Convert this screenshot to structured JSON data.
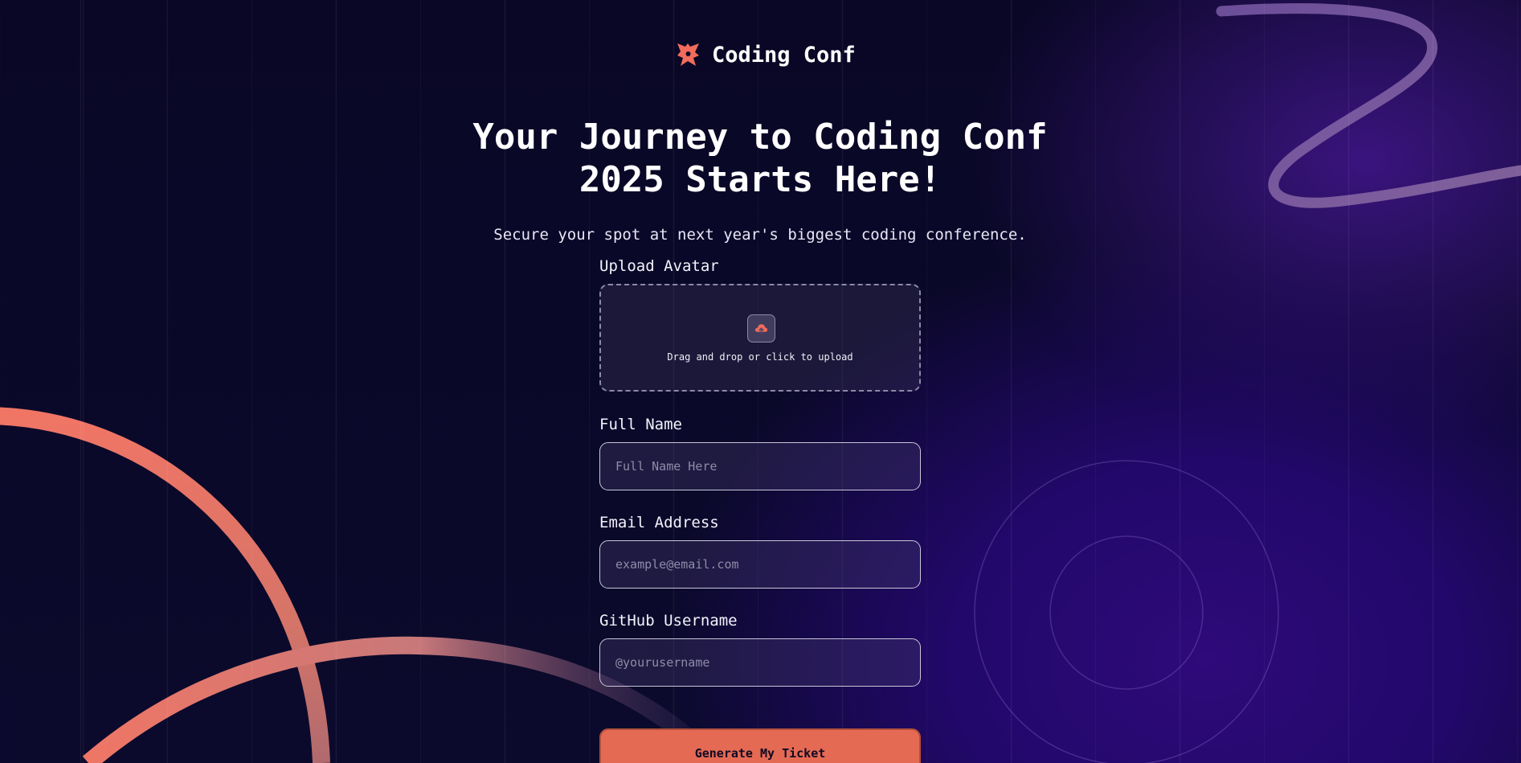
{
  "brand": {
    "name": "Coding Conf",
    "logo_icon": "coding-conf-logo-icon"
  },
  "hero": {
    "title_line1": "Your Journey to Coding Conf",
    "title_line2": "2025 Starts Here!",
    "subtitle": "Secure your spot at next year's biggest coding conference."
  },
  "form": {
    "avatar": {
      "label": "Upload Avatar",
      "hint": "Drag and drop or click to upload",
      "icon": "upload-cloud-icon"
    },
    "full_name": {
      "label": "Full Name",
      "value": "",
      "placeholder": "Full Name Here"
    },
    "email": {
      "label": "Email Address",
      "value": "",
      "placeholder": "example@email.com"
    },
    "github": {
      "label": "GitHub Username",
      "value": "",
      "placeholder": "@yourusername"
    },
    "submit_label": "Generate My Ticket"
  },
  "colors": {
    "accent": "#e56a53",
    "background": "#0a0726",
    "glow": "#2e0a7a"
  }
}
